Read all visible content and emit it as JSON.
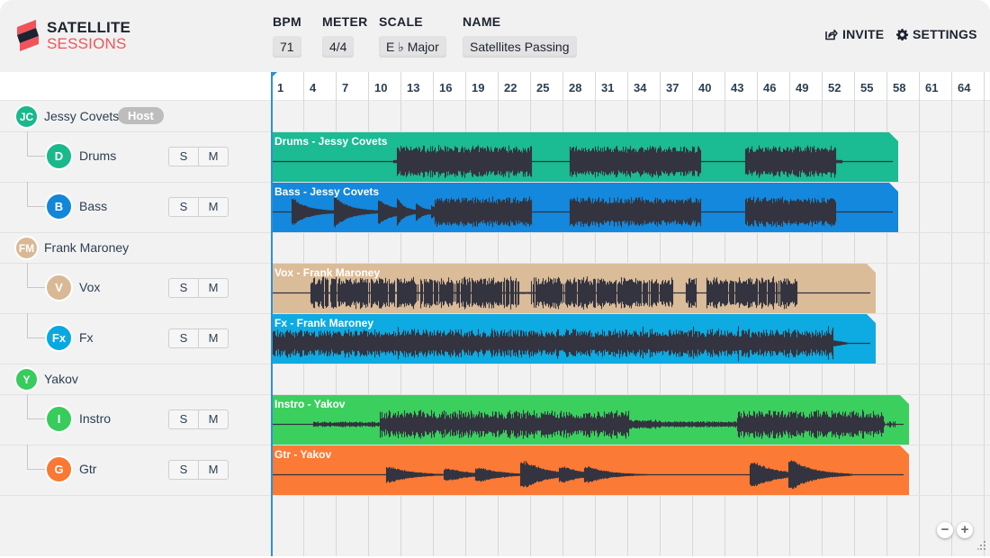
{
  "app": {
    "brand_line1": "SATELLITE",
    "brand_line2": "SESSIONS",
    "brand_colors": {
      "accent": "#f0545a",
      "dark": "#1d2330"
    }
  },
  "header": {
    "fields": [
      {
        "label": "BPM",
        "value": "71"
      },
      {
        "label": "METER",
        "value": "4/4"
      },
      {
        "label": "SCALE",
        "value": "E ♭ Major"
      },
      {
        "label": "NAME",
        "value": "Satellites Passing"
      }
    ],
    "invite_label": "INVITE",
    "invite_icon": "share-icon",
    "settings_label": "SETTINGS",
    "settings_icon": "gear-icon"
  },
  "ruler": {
    "bars": [
      "1",
      "4",
      "7",
      "10",
      "13",
      "16",
      "19",
      "22",
      "25",
      "28",
      "31",
      "34",
      "37",
      "40",
      "43",
      "46",
      "49",
      "52",
      "55",
      "58",
      "61",
      "64"
    ]
  },
  "playhead_bar": 1,
  "users": [
    {
      "name": "Jessy Covets",
      "initials": "JC",
      "color": "#19b98c",
      "badge": "Host",
      "tracks": [
        {
          "name": "Drums",
          "initial": "D",
          "color": "#19b98c",
          "clip_label": "Drums - Jessy Covets",
          "clip_color": "#1bbb93",
          "solo": "S",
          "mute": "M"
        },
        {
          "name": "Bass",
          "initial": "B",
          "color": "#1286d8",
          "clip_label": "Bass - Jessy Covets",
          "clip_color": "#1488dc",
          "solo": "S",
          "mute": "M"
        }
      ]
    },
    {
      "name": "Frank Maroney",
      "initials": "FM",
      "color": "#d9b995",
      "badge": "",
      "tracks": [
        {
          "name": "Vox",
          "initial": "V",
          "color": "#d9b995",
          "clip_label": "Vox - Frank Maroney",
          "clip_color": "#dbbc99",
          "solo": "S",
          "mute": "M"
        },
        {
          "name": "Fx",
          "initial": "Fx",
          "color": "#0aa8e0",
          "clip_label": "Fx - Frank Maroney",
          "clip_color": "#0eaae2",
          "solo": "S",
          "mute": "M"
        }
      ]
    },
    {
      "name": "Yakov",
      "initials": "Y",
      "color": "#37cc5c",
      "badge": "",
      "tracks": [
        {
          "name": "Instro",
          "initial": "I",
          "color": "#37cc5c",
          "clip_label": "Instro - Yakov",
          "clip_color": "#3bd05e",
          "solo": "S",
          "mute": "M"
        },
        {
          "name": "Gtr",
          "initial": "G",
          "color": "#f97834",
          "clip_label": "Gtr - Yakov",
          "clip_color": "#fb7a35",
          "solo": "S",
          "mute": "M"
        }
      ]
    }
  ],
  "zoom_controls": {
    "zoom_out": "−",
    "zoom_in": "+"
  }
}
